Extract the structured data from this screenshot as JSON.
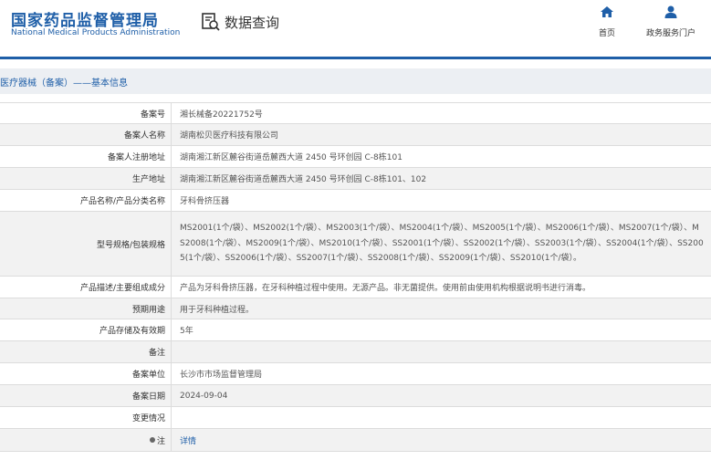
{
  "header": {
    "logo_cn": "国家药品监督管理局",
    "logo_en": "National Medical Products Administration",
    "query_title": "数据查询",
    "nav": [
      {
        "label": "首页",
        "icon": "home-icon"
      },
      {
        "label": "政务服务门户",
        "icon": "user-icon"
      }
    ],
    "brand_color": "#1f5fa8"
  },
  "breadcrumb": "医疗器械（备案）——基本信息",
  "rows": [
    {
      "label": "备案号",
      "value": "湘长械备20221752号"
    },
    {
      "label": "备案人名称",
      "value": "湖南松贝医疗科技有限公司"
    },
    {
      "label": "备案人注册地址",
      "value": "湖南湘江新区麓谷街道岳麓西大道 2450 号环创园 C-8栋101"
    },
    {
      "label": "生产地址",
      "value": "湖南湘江新区麓谷街道岳麓西大道 2450 号环创园 C-8栋101、102"
    },
    {
      "label": "产品名称/产品分类名称",
      "value": "牙科骨挤压器"
    },
    {
      "label": "型号规格/包装规格",
      "value": "MS2001(1个/袋）、MS2002(1个/袋）、MS2003(1个/袋）、MS2004(1个/袋）、MS2005(1个/袋）、MS2006(1个/袋）、MS2007(1个/袋）、MS2008(1个/袋）、MS2009(1个/袋）、MS2010(1个/袋）、SS2001(1个/袋）、SS2002(1个/袋）、SS2003(1个/袋）、SS2004(1个/袋）、SS2005(1个/袋）、SS2006(1个/袋）、SS2007(1个/袋）、SS2008(1个/袋）、SS2009(1个/袋）、SS2010(1个/袋）。"
    },
    {
      "label": "产品描述/主要组成成分",
      "value": "产品为牙科骨挤压器，在牙科种植过程中使用。无源产品。非无菌提供。使用前由使用机构根据说明书进行消毒。"
    },
    {
      "label": "预期用途",
      "value": "用于牙科种植过程。"
    },
    {
      "label": "产品存储及有效期",
      "value": "5年"
    },
    {
      "label": "备注",
      "value": ""
    },
    {
      "label": "备案单位",
      "value": "长沙市市场监督管理局"
    },
    {
      "label": "备案日期",
      "value": "2024-09-04"
    },
    {
      "label": "变更情况",
      "value": ""
    },
    {
      "label": "注",
      "value": "详情"
    }
  ]
}
